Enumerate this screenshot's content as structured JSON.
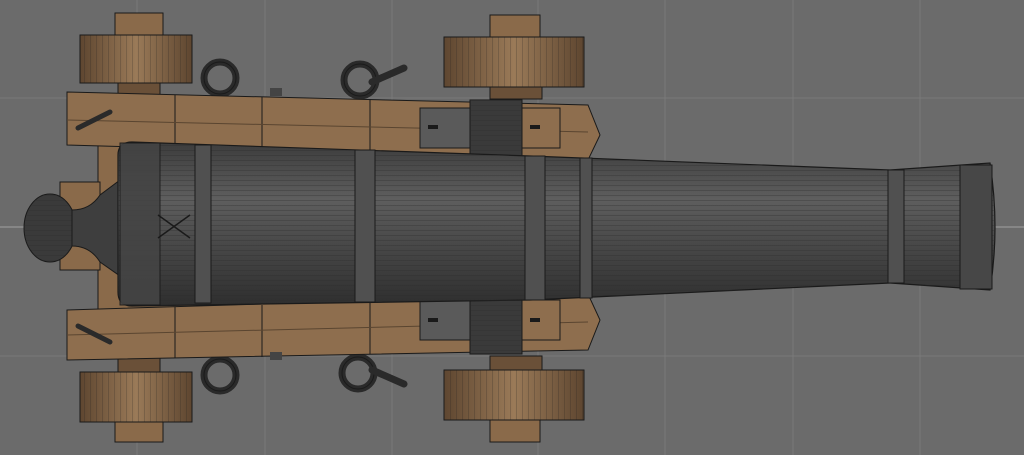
{
  "viewport": {
    "background_color": "#6b6b6b",
    "grid_color": "#7a7a7a",
    "axis_color": "#9a9a9a",
    "wireframe_color": "#1a1a1a"
  },
  "model": {
    "barrel_color": "#4a4a4a",
    "barrel_highlight": "#5c5c5c",
    "carriage_color": "#8a6a4a",
    "wheel_color": "#7a5f45",
    "metal_color": "#3a3a3a",
    "icons": [
      "cannon-barrel",
      "carriage-cheek",
      "wheel",
      "ring-bolt",
      "trunnion",
      "cascabel"
    ]
  }
}
